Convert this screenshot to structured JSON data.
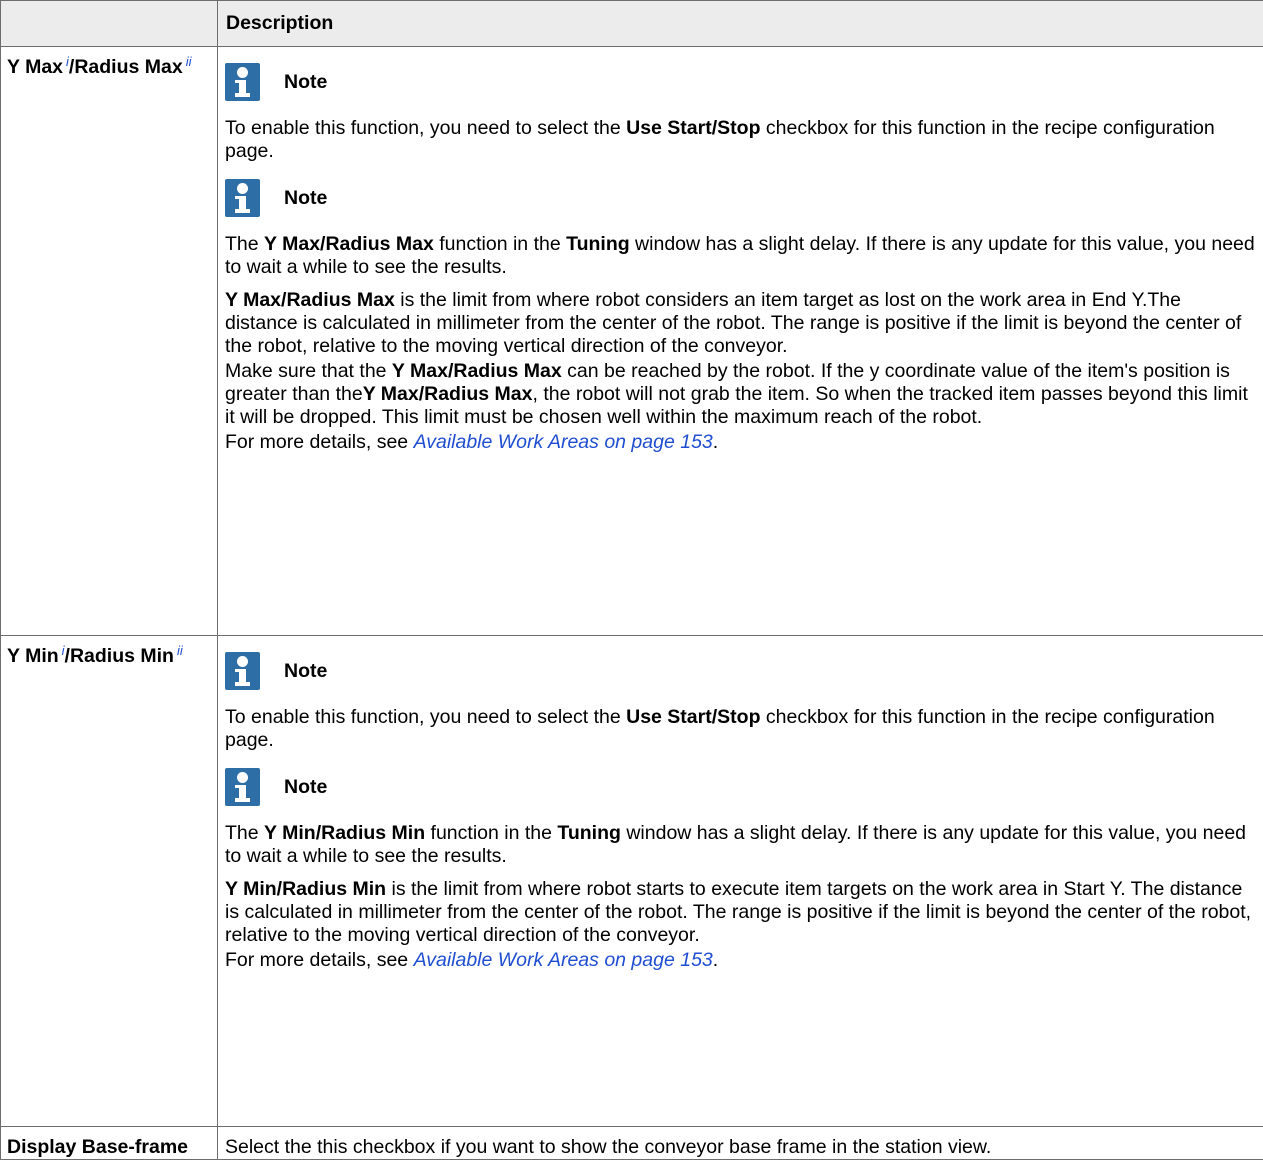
{
  "header": {
    "col1": "",
    "col2": "Description"
  },
  "rows": [
    {
      "param_a": "Y Max",
      "sup_a": "i",
      "param_sep": "/Radius Max",
      "sup_b": "ii",
      "note1_label": "Note",
      "note1_text": {
        "t1": "To enable this function, you need to select the ",
        "b1": "Use Start",
        "t2": "/",
        "b2": "Stop",
        "t3": " checkbox for this function in the recipe configuration page."
      },
      "note2_label": "Note",
      "note2_text": {
        "t1": "The ",
        "b1": "Y Max",
        "t2": "/",
        "b2": "Radius Max",
        "t3": "  function in the ",
        "b3": "Tuning",
        "t4": " window has a slight delay. If there is any update for this value, you need to wait a while to see the results."
      },
      "para1": {
        "b1": "Y Max",
        "t1": "/",
        "b2": "Radius Max",
        "t2": " is the limit from where robot considers an item target as lost on the work area in End Y.The distance is calculated in millimeter from the center of the robot. The range is positive if the limit is beyond the center of the robot, relative to the moving vertical direction of the conveyor."
      },
      "para2": {
        "t1": "Make sure that the ",
        "b1": "Y Max",
        "t2": "/",
        "b2": "Radius Max",
        "t3": " can be reached by the robot. If the y coordinate value of the item's position is greater than the",
        "b3": "Y Max",
        "t4": "/",
        "b4": "Radius Max",
        "t5": ", the robot will not grab the item. So when the tracked item passes beyond this limit it will be dropped. This limit must be chosen well within the maximum reach of the robot."
      },
      "more": {
        "t1": "For more details, see ",
        "link": "Available Work Areas on page 153",
        "t2": "."
      }
    },
    {
      "param_a": "Y Min",
      "sup_a": "i",
      "param_sep": "/Radius Min",
      "sup_b": "ii",
      "note1_label": "Note",
      "note1_text": {
        "t1": "To enable this function, you need to select the ",
        "b1": "Use Start",
        "t2": "/",
        "b2": "Stop",
        "t3": " checkbox for this function in the recipe configuration page."
      },
      "note2_label": "Note",
      "note2_text": {
        "t1": "The ",
        "b1": "Y Min",
        "t2": "/",
        "b2": "Radius Min",
        "t3": " function in the ",
        "b3": "Tuning",
        "t4": " window has a slight delay. If there is any update for this value, you need to wait a while to see the results."
      },
      "para1": {
        "b1": "Y Min",
        "t1": "/",
        "b2": "Radius Min",
        "t2": " is the limit from where robot starts to execute item targets on the work area in Start Y. The distance is calculated in millimeter from the center of the robot. The range is positive if the limit is beyond the center of the robot, relative to the moving vertical direction of the conveyor."
      },
      "more": {
        "t1": "For more details, see ",
        "link": "Available Work Areas on page 153",
        "t2": "."
      }
    },
    {
      "param": "Display Base-frame",
      "text": "Select the this checkbox if you want to show the conveyor base frame in the station view."
    }
  ]
}
